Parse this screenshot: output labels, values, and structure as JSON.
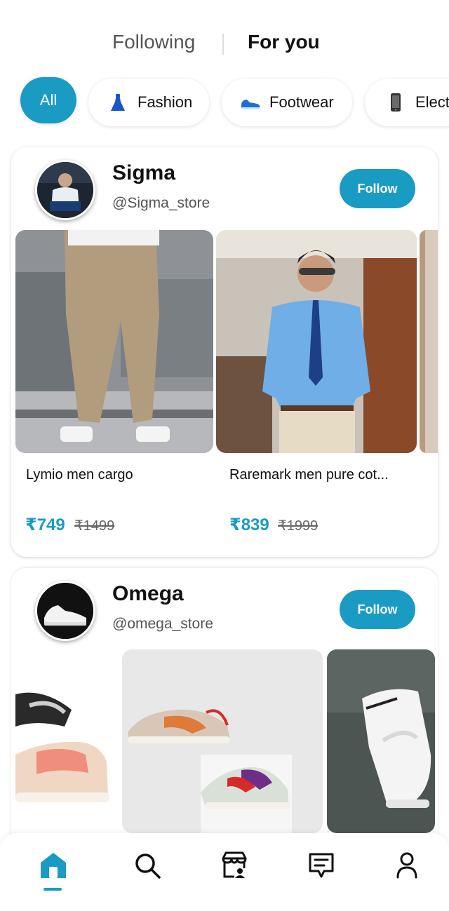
{
  "top_tabs": {
    "following": "Following",
    "for_you": "For you"
  },
  "categories": [
    {
      "label": "All",
      "selected": true
    },
    {
      "label": "Fashion",
      "icon": "dress-icon"
    },
    {
      "label": "Footwear",
      "icon": "sneaker-icon"
    },
    {
      "label": "Electr",
      "icon": "phone-icon"
    }
  ],
  "stores": [
    {
      "name": "Sigma",
      "handle": "@Sigma_store",
      "follow_label": "Follow",
      "products": [
        {
          "name": "Lymio men cargo",
          "price": "₹749",
          "mrp": "₹1499"
        },
        {
          "name": "Raremark men pure cot...",
          "price": "₹839",
          "mrp": "₹1999"
        }
      ]
    },
    {
      "name": "Omega",
      "handle": "@omega_store",
      "follow_label": "Follow"
    }
  ],
  "bottom_nav": [
    {
      "name": "home-icon",
      "active": true
    },
    {
      "name": "search-icon"
    },
    {
      "name": "store-icon"
    },
    {
      "name": "message-icon"
    },
    {
      "name": "profile-icon"
    }
  ],
  "colors": {
    "accent": "#1a9bc4",
    "text": "#111111",
    "muted": "#555555"
  }
}
